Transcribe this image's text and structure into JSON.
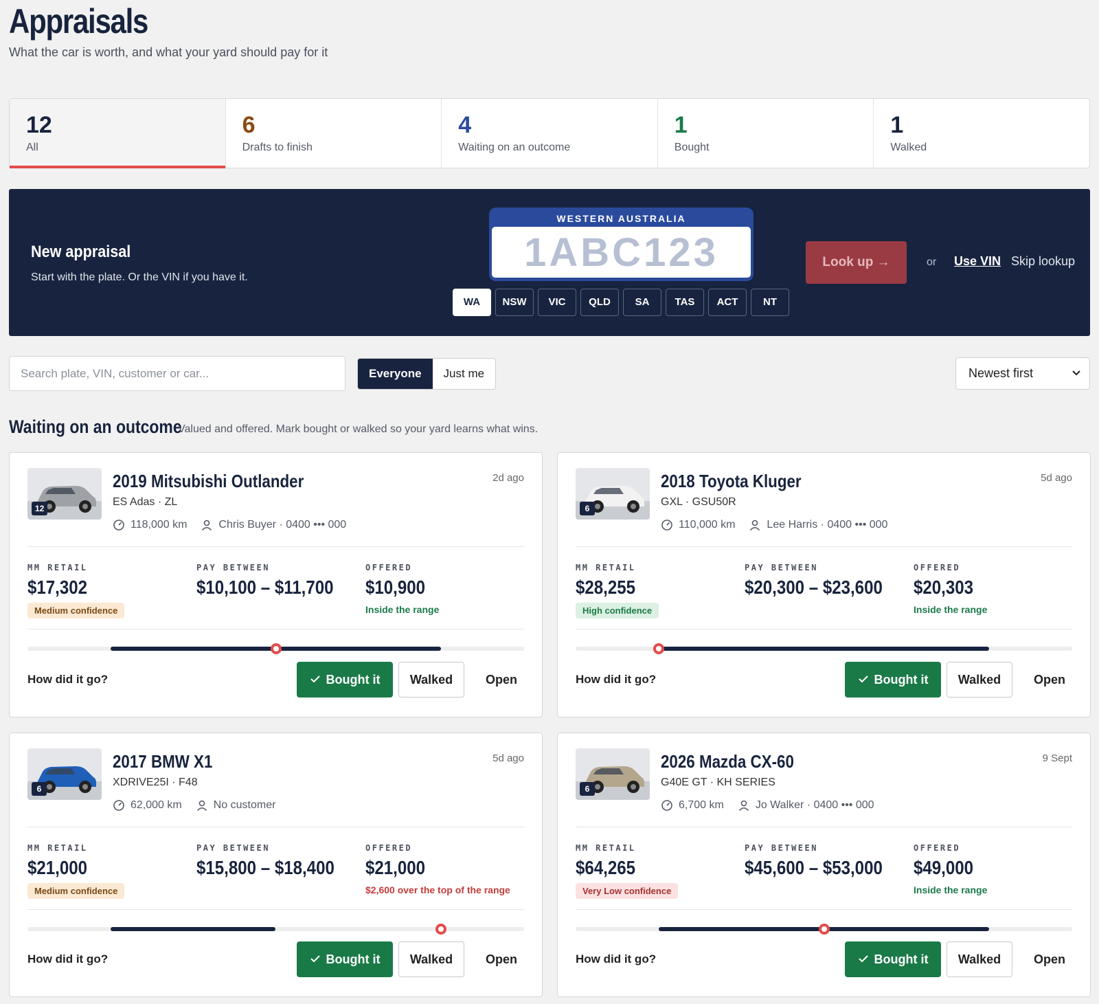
{
  "header": {
    "title": "Appraisals",
    "subtitle": "What the car is worth, and what your yard should pay for it"
  },
  "stats": [
    {
      "count": "12",
      "label": "All",
      "color": "#18233d",
      "active": true
    },
    {
      "count": "6",
      "label": "Drafts to finish",
      "color": "#8a4a0f",
      "active": false
    },
    {
      "count": "4",
      "label": "Waiting on an outcome",
      "color": "#2a4a9c",
      "active": false
    },
    {
      "count": "1",
      "label": "Bought",
      "color": "#1b7a48",
      "active": false
    },
    {
      "count": "1",
      "label": "Walked",
      "color": "#18233d",
      "active": false
    }
  ],
  "new_appraisal": {
    "title": "New appraisal",
    "subtitle": "Start with the plate. Or the VIN if you have it.",
    "plate_state": "WESTERN AUSTRALIA",
    "plate_placeholder": "1ABC123",
    "states": [
      "WA",
      "NSW",
      "VIC",
      "QLD",
      "SA",
      "TAS",
      "ACT",
      "NT"
    ],
    "selected_state": "WA",
    "lookup_label": "Look up →",
    "or_label": "or",
    "use_vin_label": "Use VIN",
    "skip_label": "Skip lookup"
  },
  "filters": {
    "search_placeholder": "Search plate, VIN, customer or car...",
    "scope_options": [
      "Everyone",
      "Just me"
    ],
    "scope_selected": "Everyone",
    "sort_selected": "Newest first"
  },
  "section": {
    "title": "Waiting on an outcome",
    "subtitle": "Valued and offered. Mark bought or walked so your yard learns what wins."
  },
  "labels": {
    "retail": "MM RETAIL",
    "pay_between": "PAY BETWEEN",
    "offered": "OFFERED",
    "how": "How did it go?",
    "bought": "Bought it",
    "walked": "Walked",
    "open": "Open"
  },
  "cards": [
    {
      "name": "2019 Mitsubishi Outlander",
      "variant": "ES Adas · ZL",
      "when": "2d ago",
      "photos": "12",
      "km": "118,000 km",
      "customer": "Chris Buyer · 0400 ••• 000",
      "retail": "$17,302",
      "confidence": "Medium confidence",
      "confidence_level": "medium",
      "pay_between": "$10,100 – $11,700",
      "offered": "$10,900",
      "offer_note": "Inside the range",
      "offer_status": "inside",
      "car_color": "#9ea2a6",
      "range_start_pct": 0.167,
      "range_end_pct": 0.833,
      "offer_pct": 0.5
    },
    {
      "name": "2018 Toyota Kluger",
      "variant": "GXL · GSU50R",
      "when": "5d ago",
      "photos": "6",
      "km": "110,000 km",
      "customer": "Lee Harris · 0400 ••• 000",
      "retail": "$28,255",
      "confidence": "High confidence",
      "confidence_level": "high",
      "pay_between": "$20,300 – $23,600",
      "offered": "$20,303",
      "offer_note": "Inside the range",
      "offer_status": "inside",
      "car_color": "#f2f2f2",
      "range_start_pct": 0.167,
      "range_end_pct": 0.833,
      "offer_pct": 0.167
    },
    {
      "name": "2017 BMW X1",
      "variant": "XDRIVE25I · F48",
      "when": "5d ago",
      "photos": "6",
      "km": "62,000 km",
      "customer": "No customer",
      "retail": "$21,000",
      "confidence": "Medium confidence",
      "confidence_level": "medium",
      "pay_between": "$15,800 – $18,400",
      "offered": "$21,000",
      "offer_note": "$2,600 over the top of the range",
      "offer_status": "over",
      "car_color": "#1f5fb8",
      "range_start_pct": 0.167,
      "range_end_pct": 0.5,
      "offer_pct": 0.833
    },
    {
      "name": "2026 Mazda CX-60",
      "variant": "G40E GT · KH SERIES",
      "when": "9 Sept",
      "photos": "6",
      "km": "6,700 km",
      "customer": "Jo Walker · 0400 ••• 000",
      "retail": "$64,265",
      "confidence": "Very Low confidence",
      "confidence_level": "verylow",
      "pay_between": "$45,600 – $53,000",
      "offered": "$49,000",
      "offer_note": "Inside the range",
      "offer_status": "inside",
      "car_color": "#b3a68c",
      "range_start_pct": 0.167,
      "range_end_pct": 0.833,
      "offer_pct": 0.5
    }
  ]
}
